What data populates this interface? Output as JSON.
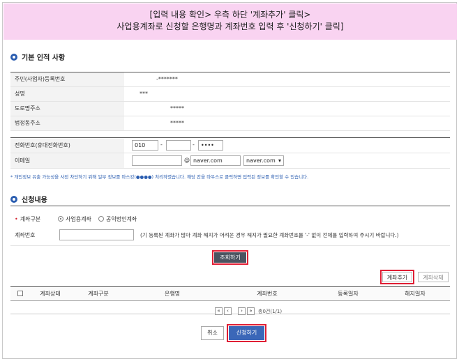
{
  "banner": {
    "line1": "[입력 내용 확인> 우측 하단 '계좌추가' 클릭>",
    "line2": "사업용계좌로 신청할 은행명과 계좌번호 입력 후 '신청하기' 클릭]"
  },
  "basic": {
    "title": "기본 인적 사항",
    "rows": [
      {
        "label": "주민(사업자)등록번호",
        "value": "-*******"
      },
      {
        "label": "성명",
        "value": "***"
      },
      {
        "label": "도로명주소",
        "value": "*****"
      },
      {
        "label": "법정동주소",
        "value": "*****"
      }
    ],
    "phone_label": "전화번호(휴대전화번호)",
    "phone": [
      "010",
      "",
      "••••"
    ],
    "email_label": "이메일",
    "email_local": "",
    "email_at": "@",
    "email_domain": "naver.com",
    "email_select": "naver.com",
    "note": "* 개인정보 유출 가능성을 사전 차단하기 위해 일부 정보를 마스킹(●●●●) 처리하였습니다. 해당 칸을 마우스로 클릭하면 입력된 정보를 확인할 수 있습니다."
  },
  "apply": {
    "title": "신청내용",
    "type_label": "계좌구분",
    "type_options": [
      "사업용계좌",
      "공익법인계좌"
    ],
    "account_label": "계좌번호",
    "account_value": "",
    "account_hint": "(기 등록된 계좌가 많아 계좌 해지가 어려운 경우 해지가 필요한 계좌번호를 '-' 없이 전체를 입력하여 주시기 바랍니다.)",
    "search_button": "조회하기"
  },
  "list": {
    "add_button": "계좌추가",
    "delete_button": "계좌삭제",
    "columns": [
      "계좌상태",
      "계좌구분",
      "은행명",
      "계좌번호",
      "등록일자",
      "해지일자"
    ],
    "pager": {
      "first": "«",
      "prev": "‹",
      "next": "›",
      "last": "»",
      "summary": "총0건(1/1)"
    }
  },
  "footer": {
    "cancel": "취소",
    "submit": "신청하기"
  },
  "colors": {
    "banner": "#f9d3f1",
    "accent": "#2a5db0",
    "highlight": "#e01e34",
    "dark_button": "#4a5360",
    "primary_button": "#3b67b8"
  }
}
